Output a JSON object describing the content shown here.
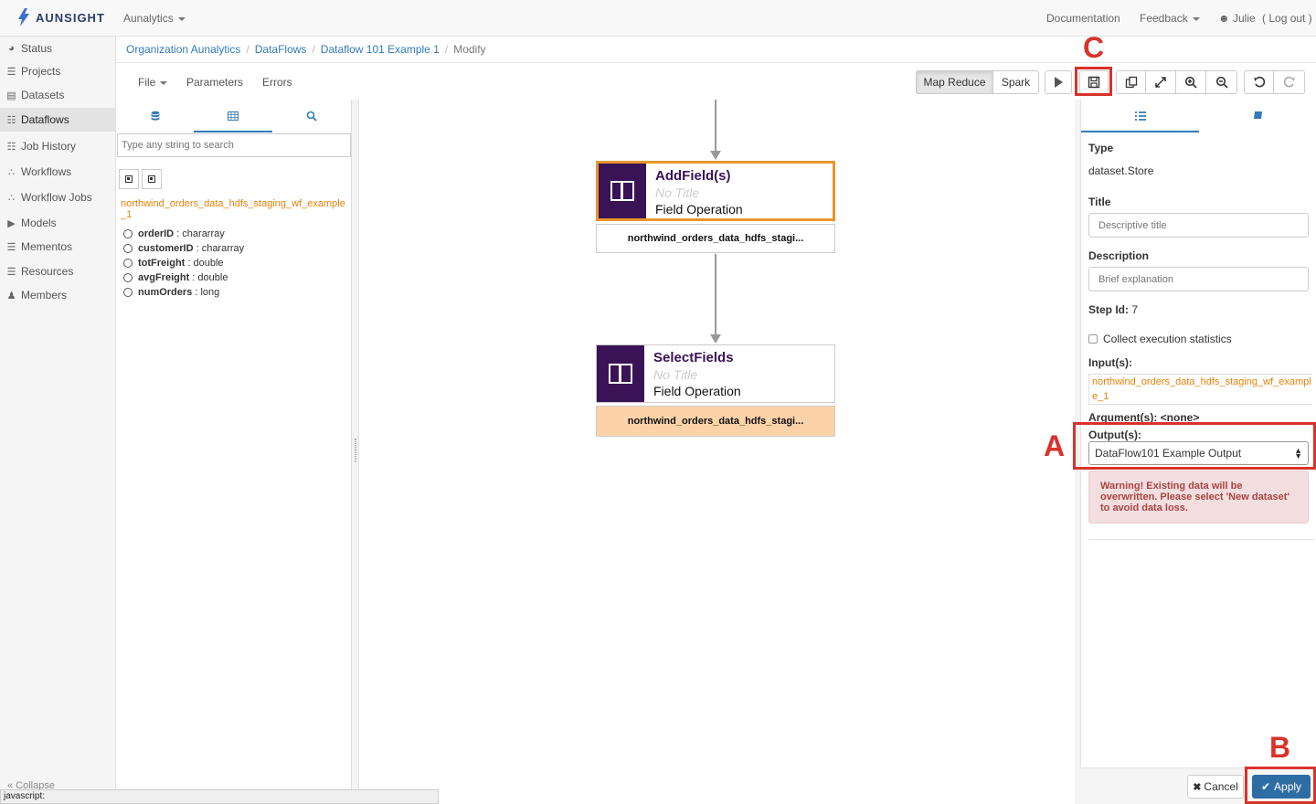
{
  "navbar": {
    "brand": "AUNSIGHT",
    "org_menu": "Aunalytics",
    "documentation": "Documentation",
    "feedback": "Feedback",
    "user": "Julie",
    "logout": "( Log out )"
  },
  "sidebar": {
    "items": [
      {
        "label": "Status",
        "icon": "dashboard-icon"
      },
      {
        "label": "Projects",
        "icon": "list-icon"
      },
      {
        "label": "Datasets",
        "icon": "file-icon"
      },
      {
        "label": "Dataflows",
        "icon": "sitemap-icon"
      },
      {
        "label": "Job History",
        "icon": "sitemap-icon"
      },
      {
        "label": "Workflows",
        "icon": "flow-icon"
      },
      {
        "label": "Workflow Jobs",
        "icon": "flow-icon"
      },
      {
        "label": "Models",
        "icon": "play-icon"
      },
      {
        "label": "Mementos",
        "icon": "list-icon"
      },
      {
        "label": "Resources",
        "icon": "list-icon"
      },
      {
        "label": "Members",
        "icon": "users-icon"
      }
    ],
    "collapse": "« Collapse"
  },
  "breadcrumb": {
    "items": [
      "Organization Aunalytics",
      "DataFlows",
      "Dataflow 101 Example 1"
    ],
    "current": "Modify"
  },
  "toolbar": {
    "file": "File",
    "parameters": "Parameters",
    "errors": "Errors",
    "map_reduce": "Map Reduce",
    "spark": "Spark",
    "selected_engine": "Map Reduce"
  },
  "left_panel": {
    "search_placeholder": "Type any string to search",
    "dataset_name": "northwind_orders_data_hdfs_staging_wf_example_1",
    "fields": [
      {
        "name": "orderID",
        "type": " : chararray"
      },
      {
        "name": "customerID",
        "type": " : chararray"
      },
      {
        "name": "totFreight",
        "type": " : double"
      },
      {
        "name": "avgFreight",
        "type": " : double"
      },
      {
        "name": "numOrders",
        "type": " : long"
      }
    ]
  },
  "canvas": {
    "nodes": [
      {
        "title": "AddField(s)",
        "subtitle": "No Title",
        "kind": "Field Operation",
        "output": "northwind_orders_data_hdfs_stagi..."
      },
      {
        "title": "SelectFields",
        "subtitle": "No Title",
        "kind": "Field Operation",
        "output": "northwind_orders_data_hdfs_stagi..."
      }
    ]
  },
  "right_panel": {
    "type_label": "Type",
    "type_value": "dataset.Store",
    "title_label": "Title",
    "title_placeholder": "Descriptive title",
    "description_label": "Description",
    "description_placeholder": "Brief explanation",
    "step_id_label": "Step Id:",
    "step_id_value": " 7",
    "collect_stats": "Collect execution statistics",
    "inputs_label": "Input(s):",
    "input_value": "northwind_orders_data_hdfs_staging_wf_example_1",
    "arguments": "Argument(s): <none>",
    "outputs_label": "Output(s):",
    "output_selected": "DataFlow101 Example Output",
    "warning_strong": "Warning!",
    "warning_text": " Existing data will be overwritten. Please select 'New dataset' to avoid data loss.",
    "cancel": "Cancel",
    "apply": "Apply"
  },
  "annotations": {
    "a": "A",
    "b": "B",
    "c": "C"
  },
  "statusbar": "javascript:",
  "colors": {
    "accent": "#337ab7",
    "node_fill": "#3a1356",
    "selected_border": "#e8962b",
    "highlight": "#fcd3a8",
    "annotation": "#d9322b",
    "dataset_link": "#e8820c"
  }
}
